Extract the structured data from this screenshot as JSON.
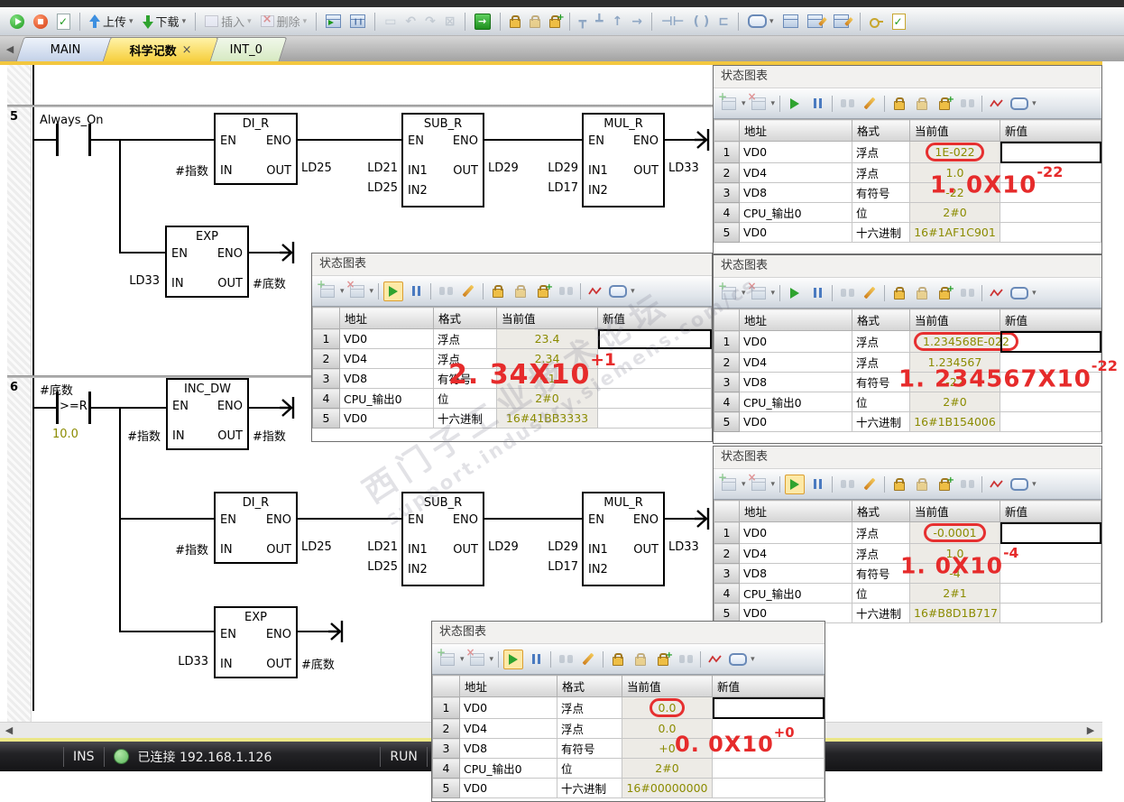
{
  "toolbar": {
    "upload_label": "上传",
    "download_label": "下载",
    "insert_label": "插入",
    "delete_label": "删除",
    "icons": [
      "run-icon",
      "stop-icon",
      "compile-icon",
      "upload-icon",
      "download-icon",
      "insert-icon",
      "delete-icon",
      "program-status-icon",
      "pause-status-icon",
      "bookmark-icon",
      "undo-icon",
      "redo-icon",
      "cancel-icon",
      "run-mode-icon",
      "force-icon",
      "unforce-icon",
      "force-all-icon",
      "branch-down-icon",
      "branch-up-icon",
      "line-up-icon",
      "line-right-icon",
      "contact-icon",
      "coil-icon",
      "box-icon",
      "tag-icon",
      "symbol-table-icon",
      "status-chart-icon",
      "data-block-icon",
      "key-icon",
      "options-icon"
    ]
  },
  "tabs": {
    "items": [
      {
        "label": "MAIN"
      },
      {
        "label": "科学记数",
        "close_glyph": "×",
        "active": true
      },
      {
        "label": "INT_0"
      }
    ]
  },
  "ladder": {
    "networks": [
      {
        "number": "5"
      },
      {
        "number": "6"
      }
    ],
    "n5": {
      "contact_label": "Always_On",
      "di_r": {
        "title": "DI_R",
        "en": "EN",
        "eno": "ENO",
        "in": "IN",
        "out": "OUT",
        "in_operand": "#指数",
        "out_operand": "LD25"
      },
      "sub_r": {
        "title": "SUB_R",
        "en": "EN",
        "eno": "ENO",
        "in1": "IN1",
        "in2": "IN2",
        "out": "OUT",
        "in1_operand": "LD21",
        "in2_operand": "LD25",
        "out_operand": "LD29"
      },
      "mul_r": {
        "title": "MUL_R",
        "en": "EN",
        "eno": "ENO",
        "in1": "IN1",
        "in2": "IN2",
        "out": "OUT",
        "in1_operand": "LD29",
        "in2_operand": "LD17",
        "out_operand": "LD33"
      },
      "exp": {
        "title": "EXP",
        "en": "EN",
        "eno": "ENO",
        "in": "IN",
        "out": "OUT",
        "in_operand": "LD33",
        "out_operand": "#底数"
      }
    },
    "n6": {
      "contact_label": "#底数",
      "contact_operator": ">=R",
      "contact_value": "10.0",
      "inc_dw": {
        "title": "INC_DW",
        "en": "EN",
        "eno": "ENO",
        "in": "IN",
        "out": "OUT",
        "in_operand": "#指数",
        "out_operand": "#指数"
      },
      "di_r": {
        "title": "DI_R",
        "en": "EN",
        "eno": "ENO",
        "in": "IN",
        "out": "OUT",
        "in_operand": "#指数",
        "out_operand": "LD25"
      },
      "sub_r": {
        "title": "SUB_R",
        "en": "EN",
        "eno": "ENO",
        "in1": "IN1",
        "in2": "IN2",
        "out": "OUT",
        "in1_operand": "LD21",
        "in2_operand": "LD25",
        "out_operand": "LD29"
      },
      "mul_r": {
        "title": "MUL_R",
        "en": "EN",
        "eno": "ENO",
        "in1": "IN1",
        "in2": "IN2",
        "out": "OUT",
        "in1_operand": "LD29",
        "in2_operand": "LD17",
        "out_operand": "LD33"
      },
      "exp": {
        "title": "EXP",
        "en": "EN",
        "eno": "ENO",
        "in": "IN",
        "out": "OUT",
        "in_operand": "LD33",
        "out_operand": "#底数"
      }
    }
  },
  "chart_toolbar_icons": [
    "insert-row-icon",
    "delete-row-icon",
    "chart-status-on-icon",
    "chart-status-pause-icon",
    "read-all-icon",
    "write-all-icon",
    "force-icon",
    "unforce-icon",
    "force-all-icon",
    "read-forced-icon",
    "trend-view-icon",
    "address-tag-icon"
  ],
  "charts": [
    {
      "title": "状态图表",
      "columns": [
        "地址",
        "格式",
        "当前值",
        "新值"
      ],
      "rows": [
        [
          "VD0",
          "浮点",
          "23.4"
        ],
        [
          "VD4",
          "浮点",
          "2.34"
        ],
        [
          "VD8",
          "有符号",
          "+1"
        ],
        [
          "CPU_输出0",
          "位",
          "2#0"
        ],
        [
          "VD0",
          "十六进制",
          "16#41BB3333"
        ]
      ],
      "circled_row": 0,
      "monitoring": true,
      "annotation": {
        "base": "2. 34X10",
        "exp": "+1"
      }
    },
    {
      "title": "状态图表",
      "columns": [
        "地址",
        "格式",
        "当前值",
        "新值"
      ],
      "rows": [
        [
          "VD0",
          "浮点",
          "1E-022"
        ],
        [
          "VD4",
          "浮点",
          "1.0"
        ],
        [
          "VD8",
          "有符号",
          "-22"
        ],
        [
          "CPU_输出0",
          "位",
          "2#0"
        ],
        [
          "VD0",
          "十六进制",
          "16#1AF1C901"
        ]
      ],
      "circled_row": 1,
      "monitoring": false,
      "annotation": {
        "base": "1. 0X10",
        "exp": "-22"
      }
    },
    {
      "title": "状态图表",
      "columns": [
        "地址",
        "格式",
        "当前值",
        "新值"
      ],
      "rows": [
        [
          "VD0",
          "浮点",
          "1.234568E-022"
        ],
        [
          "VD4",
          "浮点",
          "1.234567"
        ],
        [
          "VD8",
          "有符号",
          "-22"
        ],
        [
          "CPU_输出0",
          "位",
          "2#0"
        ],
        [
          "VD0",
          "十六进制",
          "16#1B154006"
        ]
      ],
      "circled_row": 1,
      "monitoring": false,
      "annotation": {
        "base": "1. 234567X10",
        "exp": "-22"
      }
    },
    {
      "title": "状态图表",
      "columns": [
        "地址",
        "格式",
        "当前值",
        "新值"
      ],
      "rows": [
        [
          "VD0",
          "浮点",
          "-0.0001"
        ],
        [
          "VD4",
          "浮点",
          "1.0"
        ],
        [
          "VD8",
          "有符号",
          "-4"
        ],
        [
          "CPU_输出0",
          "位",
          "2#1"
        ],
        [
          "VD0",
          "十六进制",
          "16#B8D1B717"
        ]
      ],
      "circled_row": 1,
      "monitoring": true,
      "annotation": {
        "base": "1. 0X10",
        "exp": "-4"
      }
    },
    {
      "title": "状态图表",
      "columns": [
        "地址",
        "格式",
        "当前值",
        "新值"
      ],
      "rows": [
        [
          "VD0",
          "浮点",
          "0.0"
        ],
        [
          "VD4",
          "浮点",
          "0.0"
        ],
        [
          "VD8",
          "有符号",
          "+0"
        ],
        [
          "CPU_输出0",
          "位",
          "2#0"
        ],
        [
          "VD0",
          "十六进制",
          "16#00000000"
        ]
      ],
      "circled_row": 1,
      "monitoring": true,
      "annotation": {
        "base": "0. 0X10",
        "exp": "+0"
      }
    }
  ],
  "watermark": {
    "line1": "西门子工业技术论坛",
    "line2": "support.industry.siemens.com/cs"
  },
  "statusbar": {
    "ins": "INS",
    "connection": "已连接 192.168.1.126",
    "mode": "RUN"
  }
}
